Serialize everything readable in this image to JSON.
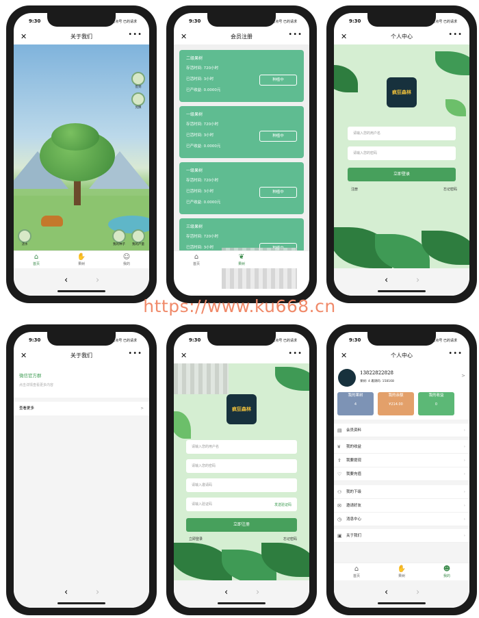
{
  "status": {
    "time": "9:30",
    "right": "已点号 已的请求"
  },
  "watermark": "https://www.ku668.cn",
  "phone1": {
    "nav_title": "关于我们",
    "top_badges": [
      "签到",
      "兑换"
    ],
    "bottom_buttons": [
      "浇水",
      "我的种子",
      "我的产量"
    ],
    "tabs": [
      "首页",
      "果树",
      "我的"
    ]
  },
  "phone2": {
    "nav_title": "会员注册",
    "cards": [
      {
        "title": "二级果树",
        "l1": "存活时间: 720小时",
        "l2": "已活时间: 3小时",
        "l3": "已产收益: 0.0000元",
        "button": "种植中"
      },
      {
        "title": "一级果树",
        "l1": "存活时间: 720小时",
        "l2": "已活时间: 3小时",
        "l3": "已产收益: 0.0000元",
        "button": "种植中"
      },
      {
        "title": "一级果树",
        "l1": "存活时间: 720小时",
        "l2": "已活时间: 3小时",
        "l3": "已产收益: 0.0000元",
        "button": "种植中"
      },
      {
        "title": "三级果树",
        "l1": "存活时间: 720小时",
        "l2": "已活时间: 3小时",
        "l3": "",
        "button": "种植中"
      }
    ],
    "tabs": [
      "首页",
      "果树",
      ""
    ]
  },
  "phone3": {
    "nav_title": "个人中心",
    "logo": "疯狂森林",
    "username_placeholder": "请输入您的用户名",
    "password_placeholder": "请输入您的密码",
    "login_button": "立即登录",
    "register_link": "注册",
    "forgot_link": "忘记密码"
  },
  "phone4": {
    "nav_title": "关于我们",
    "section_title": "微信官方群",
    "section_sub": "点击详情查看更多内容",
    "row_label": "查看更多"
  },
  "phone5": {
    "logo": "疯狂森林",
    "username_placeholder": "请输入您的用户名",
    "password_placeholder": "请输入您的密码",
    "invite_placeholder": "请输入邀请码",
    "code_placeholder": "请输入验证码",
    "send_code": "发送验证码",
    "register_button": "立即注册",
    "login_link": "立即登录",
    "forgot_link": "忘记密码"
  },
  "phone6": {
    "nav_title": "个人中心",
    "phone_number": "13822822828",
    "meta": "果树: 4  邀请码: 158168",
    "stats": [
      {
        "label": "我的果树",
        "value": "4",
        "color": "#7d93b5"
      },
      {
        "label": "我的余额",
        "value": "¥214.00",
        "color": "#e3a06a"
      },
      {
        "label": "我的收益",
        "value": "0",
        "color": "#5cb876"
      }
    ],
    "menu": [
      "会员资料",
      "我的收益",
      "我要提现",
      "我要充值",
      "我的下级",
      "邀请好友",
      "消息中心",
      "关于我们"
    ],
    "tabs": [
      "首页",
      "果树",
      "我的"
    ]
  }
}
